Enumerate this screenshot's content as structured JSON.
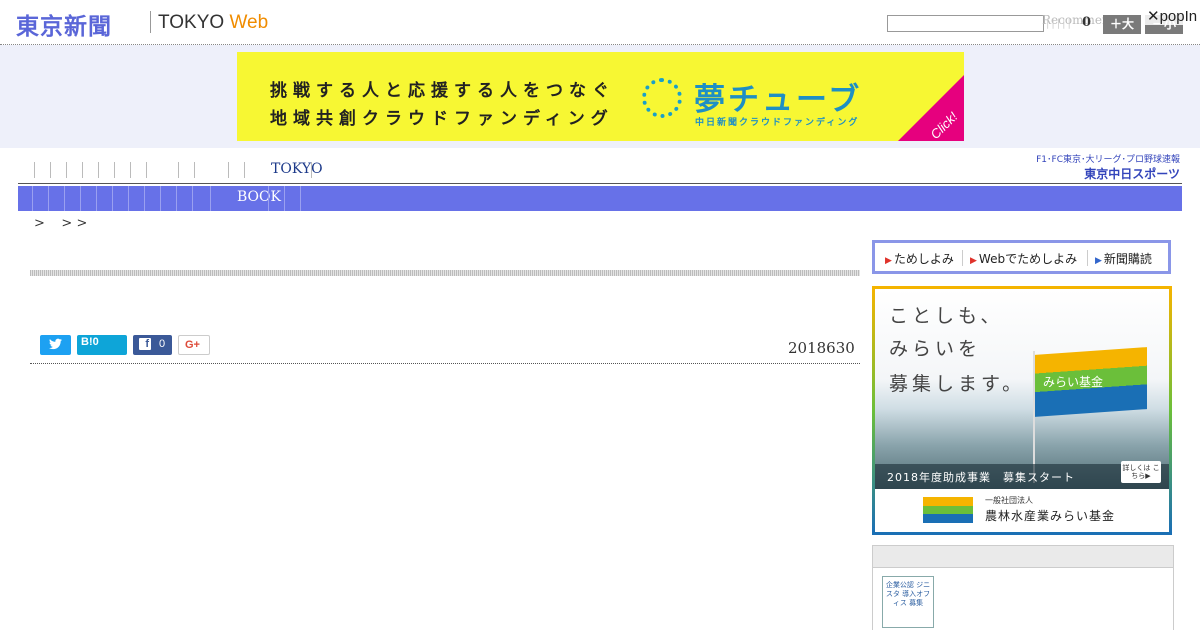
{
  "header": {
    "logo_jp": "東京新聞",
    "logo_en": "TOKYO",
    "logo_web": "Web",
    "recommend": "Recommend",
    "count": "0",
    "font_large": "＋大",
    "font_small": "－小",
    "popin": "✕popIn"
  },
  "banner": {
    "line1": "挑戦する人と応援する人をつなぐ",
    "line2": "地域共創クラウドファンディング",
    "brand": "夢チューブ",
    "brand_sub": "中日新聞クラウドファンディング",
    "click": "Click!"
  },
  "nav1": {
    "item": "TOKYO"
  },
  "chunichi": {
    "top": "F1･FC東京･大リーグ･プロ野球速報",
    "bottom": "東京中日スポーツ"
  },
  "nav2": {
    "item": "BOOK"
  },
  "breadcrumb": ">    > >",
  "article": {
    "date": "2018630",
    "share": {
      "twitter_icon": "twitter-icon",
      "hatena": "B!0",
      "facebook_count": "0",
      "gplus": "G+"
    }
  },
  "sidebar": {
    "tame": [
      "ためしよみ",
      "Webでためしよみ",
      "新聞購読"
    ],
    "mirai": {
      "copy1": "ことしも、",
      "copy2": "みらいを",
      "copy3": "募集します。",
      "flag_label": "みらい基金",
      "strip": "2018年度助成事業　募集スタート",
      "details": "詳しくは こちら▶",
      "org_small": "一般社団法人",
      "org_name": "農林水産業みらい基金"
    },
    "badge": "企業公認 ジニスタ 導入オフィス 募集"
  }
}
